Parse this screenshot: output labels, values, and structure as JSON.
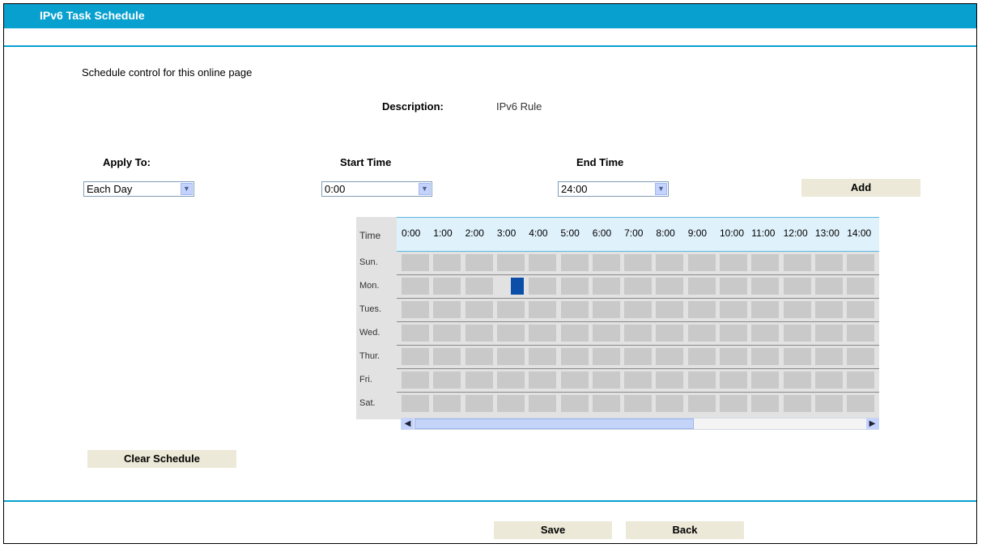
{
  "header": {
    "title": "IPv6 Task Schedule"
  },
  "intro": {
    "text": "Schedule control for this online page"
  },
  "description": {
    "label": "Description:",
    "value": "IPv6 Rule"
  },
  "apply_to": {
    "label": "Apply To:",
    "value": "Each Day"
  },
  "start_time": {
    "label": "Start Time",
    "value": "0:00"
  },
  "end_time": {
    "label": "End Time",
    "value": "24:00"
  },
  "buttons": {
    "add": "Add",
    "clear": "Clear Schedule",
    "save": "Save",
    "back": "Back"
  },
  "schedule": {
    "corner_label": "Time",
    "hours": [
      "0:00",
      "1:00",
      "2:00",
      "3:00",
      "4:00",
      "5:00",
      "6:00",
      "7:00",
      "8:00",
      "9:00",
      "10:00",
      "11:00",
      "12:00",
      "13:00",
      "14:00"
    ],
    "days": [
      "Sun.",
      "Mon.",
      "Tues.",
      "Wed.",
      "Thur.",
      "Fri.",
      "Sat."
    ],
    "active_cells": [
      {
        "day": "Mon.",
        "hour": "3:00"
      }
    ],
    "active_color": "#0a4ea8"
  },
  "colors": {
    "accent": "#07a0cf",
    "cell": "#c9c9c9",
    "button": "#ece9d8"
  }
}
